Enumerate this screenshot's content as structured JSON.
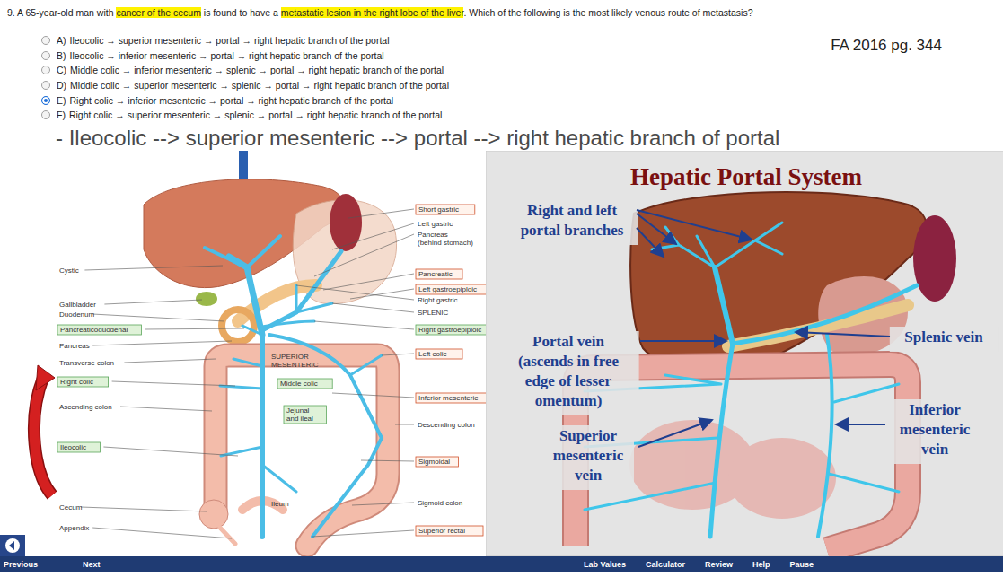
{
  "question": {
    "segments": [
      {
        "text": "9. A 65-year-old man with ",
        "highlighted": false
      },
      {
        "text": "cancer of the cecum",
        "highlighted": true
      },
      {
        "text": " is found to have a ",
        "highlighted": false
      },
      {
        "text": "metastatic lesion in the right lobe of the liver",
        "highlighted": true
      },
      {
        "text": ". Which of the following is the most likely venous route of metastasis?",
        "highlighted": false
      }
    ]
  },
  "options": [
    {
      "label": "A)",
      "text": "Ileocolic → superior mesenteric → portal → right hepatic branch of the portal",
      "selected": false
    },
    {
      "label": "B)",
      "text": "Ileocolic → inferior mesenteric → portal → right hepatic branch of the portal",
      "selected": false
    },
    {
      "label": "C)",
      "text": "Middle colic → inferior mesenteric → splenic → portal → right hepatic branch of the portal",
      "selected": false
    },
    {
      "label": "D)",
      "text": "Middle colic → superior mesenteric → splenic → portal → right hepatic branch of the portal",
      "selected": false
    },
    {
      "label": "E)",
      "text": "Right colic → inferior mesenteric → portal → right hepatic branch of the portal",
      "selected": true
    },
    {
      "label": "F)",
      "text": "Right colic → superior mesenteric → splenic → portal → right hepatic branch of the portal",
      "selected": false
    }
  ],
  "reference": "FA 2016 pg. 344",
  "answer_note": "- Ileocolic --> superior mesenteric --> portal --> right hepatic branch of portal",
  "left_diagram": {
    "labels": [
      {
        "lines": [
          "Cystic"
        ],
        "kind": "plain"
      },
      {
        "lines": [
          "Gallbladder"
        ],
        "kind": "plain"
      },
      {
        "lines": [
          "Duodenum"
        ],
        "kind": "plain"
      },
      {
        "lines": [
          "Pancreaticoduodenal"
        ],
        "kind": "boxed",
        "color": "#5aa55a"
      },
      {
        "lines": [
          "Pancreas"
        ],
        "kind": "plain"
      },
      {
        "lines": [
          "Transverse colon"
        ],
        "kind": "plain"
      },
      {
        "lines": [
          "Right colic"
        ],
        "kind": "boxed",
        "color": "#5aa55a"
      },
      {
        "lines": [
          "Ascending colon"
        ],
        "kind": "plain"
      },
      {
        "lines": [
          "Ileocolic"
        ],
        "kind": "boxed",
        "color": "#5aa55a"
      },
      {
        "lines": [
          "Cecum"
        ],
        "kind": "plain"
      },
      {
        "lines": [
          "Appendix"
        ],
        "kind": "plain"
      },
      {
        "lines": [
          "Short gastric"
        ],
        "kind": "boxed",
        "color": "#d0502a"
      },
      {
        "lines": [
          "Left gastric"
        ],
        "kind": "plain"
      },
      {
        "lines": [
          "Pancreas",
          "(behind stomach)"
        ],
        "kind": "plain"
      },
      {
        "lines": [
          "Pancreatic"
        ],
        "kind": "boxed",
        "color": "#d0502a"
      },
      {
        "lines": [
          "Left gastroepiploic"
        ],
        "kind": "boxed",
        "color": "#d0502a"
      },
      {
        "lines": [
          "Right gastric"
        ],
        "kind": "plain"
      },
      {
        "lines": [
          "SPLENIC"
        ],
        "kind": "plain"
      },
      {
        "lines": [
          "Right gastroepiploic"
        ],
        "kind": "boxed",
        "color": "#5aa55a"
      },
      {
        "lines": [
          "Left colic"
        ],
        "kind": "boxed",
        "color": "#d0502a"
      },
      {
        "lines": [
          "Inferior mesenteric"
        ],
        "kind": "boxed",
        "color": "#d0502a"
      },
      {
        "lines": [
          "Descending colon"
        ],
        "kind": "plain"
      },
      {
        "lines": [
          "Sigmoidal"
        ],
        "kind": "boxed",
        "color": "#d0502a"
      },
      {
        "lines": [
          "Sigmoid colon"
        ],
        "kind": "plain"
      },
      {
        "lines": [
          "Superior rectal"
        ],
        "kind": "boxed",
        "color": "#d0502a"
      },
      {
        "lines": [
          "SUPERIOR",
          "MESENTERIC"
        ],
        "kind": "plain"
      },
      {
        "lines": [
          "Middle colic"
        ],
        "kind": "boxed",
        "color": "#5aa55a"
      },
      {
        "lines": [
          "Jejunal",
          "and ileal"
        ],
        "kind": "boxed",
        "color": "#5aa55a"
      },
      {
        "lines": [
          "Ileum"
        ],
        "kind": "plain"
      }
    ]
  },
  "right_diagram": {
    "title": "Hepatic Portal System",
    "labels": [
      {
        "lines": [
          "Right and left",
          "portal branches"
        ]
      },
      {
        "lines": [
          "Portal vein",
          "(ascends in free",
          "edge of lesser",
          "omentum)"
        ]
      },
      {
        "lines": [
          "Superior",
          "mesenteric",
          "vein"
        ]
      },
      {
        "lines": [
          "Splenic vein"
        ]
      },
      {
        "lines": [
          "Inferior",
          "mesenteric",
          "vein"
        ]
      }
    ]
  },
  "nav": {
    "left": [
      "Previous",
      "Next"
    ],
    "right": [
      "Lab Values",
      "Calculator",
      "Review",
      "Help",
      "Pause"
    ]
  }
}
